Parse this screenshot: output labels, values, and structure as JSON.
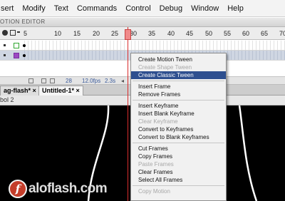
{
  "menubar": {
    "items": [
      "sert",
      "Modify",
      "Text",
      "Commands",
      "Control",
      "Debug",
      "Window",
      "Help"
    ]
  },
  "motion_tab": "OTION EDITOR",
  "ruler": {
    "numbers": [
      "5",
      "10",
      "15",
      "20",
      "25",
      "30",
      "35",
      "40",
      "45",
      "50",
      "55",
      "60",
      "65",
      "70"
    ]
  },
  "timeline_footer": {
    "fps": "12.0fps",
    "time": "2.3s",
    "frame": "28"
  },
  "doc_tabs": [
    "ag-flash*",
    "Untitled-1*"
  ],
  "scene_label": "bol 2",
  "context_menu": [
    {
      "label": "Create Motion Tween",
      "state": "normal"
    },
    {
      "label": "Create Shape Tween",
      "state": "disabled"
    },
    {
      "label": "Create Classic Tween",
      "state": "highlighted"
    },
    {
      "sep": true
    },
    {
      "label": "Insert Frame",
      "state": "normal"
    },
    {
      "label": "Remove Frames",
      "state": "normal"
    },
    {
      "sep": true
    },
    {
      "label": "Insert Keyframe",
      "state": "normal"
    },
    {
      "label": "Insert Blank Keyframe",
      "state": "normal"
    },
    {
      "label": "Clear Keyframe",
      "state": "disabled"
    },
    {
      "label": "Convert to Keyframes",
      "state": "normal"
    },
    {
      "label": "Convert to Blank Keyframes",
      "state": "normal"
    },
    {
      "sep": true
    },
    {
      "label": "Cut Frames",
      "state": "normal"
    },
    {
      "label": "Copy Frames",
      "state": "normal"
    },
    {
      "label": "Paste Frames",
      "state": "disabled"
    },
    {
      "label": "Clear Frames",
      "state": "normal"
    },
    {
      "label": "Select All Frames",
      "state": "normal"
    },
    {
      "sep": true
    },
    {
      "label": "Copy Motion",
      "state": "disabled"
    }
  ],
  "watermark": {
    "text": "aloflash.com",
    "mark": "f"
  },
  "colors": {
    "highlight": "#2e4f8f",
    "playhead": "#d92b2b",
    "layer_selected": "#cfd6e2",
    "canvas": "#000000"
  }
}
